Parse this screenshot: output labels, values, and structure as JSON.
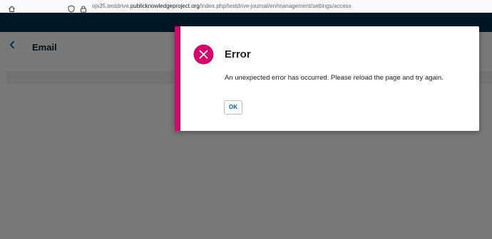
{
  "browser": {
    "url_prefix": "ojs35.testdrive.",
    "url_host": "publicknowledgeproject.org",
    "url_path": "/index.php/testdrive-journal/en/management/settings/access"
  },
  "page": {
    "title": "Email"
  },
  "modal": {
    "title": "Error",
    "message": "An unexpected error has occurred. Please reload the page and try again.",
    "ok_label": "OK",
    "accent_color": "#d00a6c",
    "icon": "error-x-icon"
  },
  "colors": {
    "header_bg": "#001724",
    "link": "#006798"
  }
}
